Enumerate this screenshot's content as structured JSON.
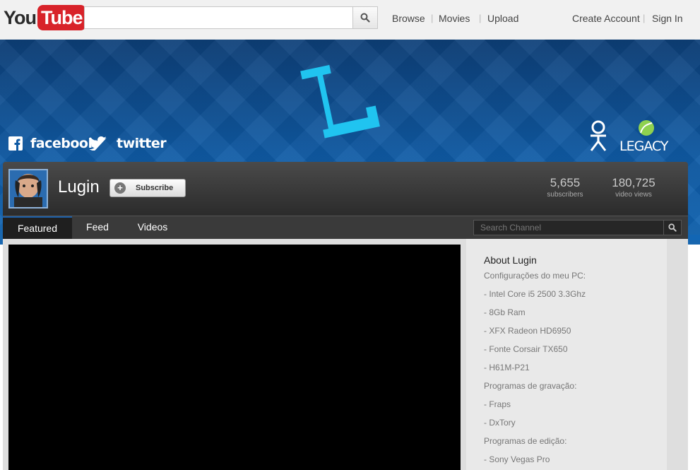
{
  "masthead": {
    "logo": {
      "you": "You",
      "tube": "Tube"
    },
    "search": {
      "placeholder": "",
      "icon": "search-icon"
    },
    "nav": {
      "browse": "Browse",
      "movies": "Movies",
      "upload": "Upload"
    },
    "account": {
      "create": "Create Account",
      "sign_in": "Sign In"
    }
  },
  "banner": {
    "letter": "L",
    "facebook": "facebook",
    "twitter": "twitter",
    "legacy": "LEGACY",
    "colors": {
      "banner": "#0f5aa4",
      "letter": "#20c4f0"
    }
  },
  "channel": {
    "name": "Lugin",
    "subscribe_label": "Subscribe",
    "stats": [
      {
        "value": "5,655",
        "label": "subscribers"
      },
      {
        "value": "180,725",
        "label": "video views"
      }
    ]
  },
  "tabs": [
    {
      "label": "Featured",
      "active": true
    },
    {
      "label": "Feed",
      "active": false
    },
    {
      "label": "Videos",
      "active": false
    }
  ],
  "channel_search": {
    "placeholder": "Search Channel"
  },
  "about": {
    "title": "About Lugin",
    "lines": [
      "Configurações do meu PC:",
      "- Intel Core i5 2500 3.3Ghz",
      "- 8Gb Ram",
      "- XFX Radeon HD6950",
      "- Fonte Corsair TX650",
      "- H61M-P21",
      "Programas de gravação:",
      "- Fraps",
      "- DxTory",
      "Programas de edição:",
      "- Sony Vegas Pro"
    ]
  }
}
